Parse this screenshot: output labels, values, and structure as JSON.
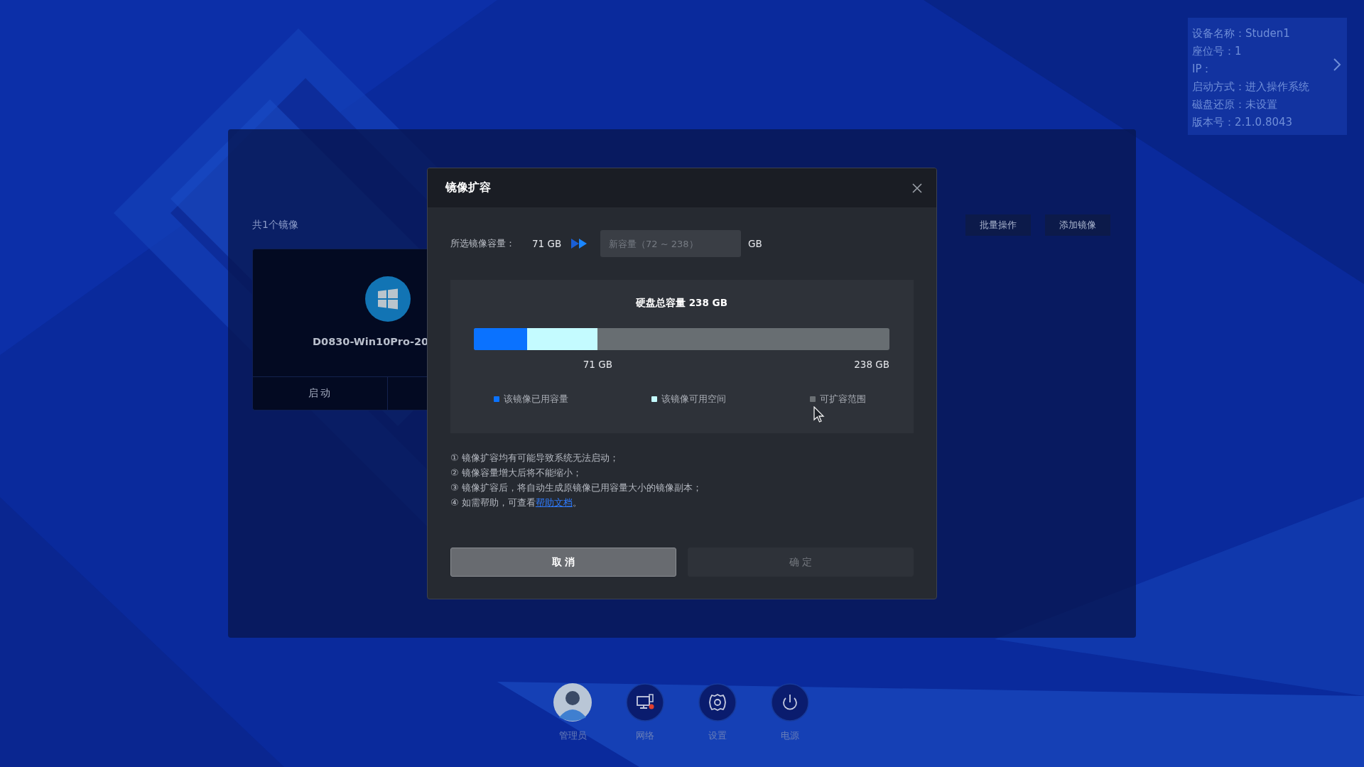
{
  "device_info": {
    "lines": [
      "设备名称：Studen1",
      "座位号：1",
      "IP：",
      "启动方式：进入操作系统",
      "磁盘还原：未设置",
      "版本号：2.1.0.8043"
    ]
  },
  "image_panel": {
    "count_label": "共1个镜像",
    "actions": [
      "批量操作",
      "添加镜像"
    ],
    "card": {
      "name": "D0830-Win10Pro-20",
      "action": "启动"
    }
  },
  "dialog": {
    "title": "镜像扩容",
    "selected_label": "所选镜像容量：",
    "selected_value": "71 GB",
    "new_capacity": {
      "placeholder": "新容量（72 ~ 238）"
    },
    "unit": "GB",
    "disk": {
      "title": "硬盘总容量 238 GB",
      "segments": [
        {
          "level": 0.128
        },
        {
          "level": 0.17
        }
      ],
      "marks": [
        "71 GB",
        "238 GB"
      ],
      "legend": [
        {
          "label": "该镜像已用容量",
          "color": "#0a72ff"
        },
        {
          "label": "该镜像可用空间",
          "color": "#c4fbff"
        },
        {
          "label": "可扩容范围",
          "color": "#6b7074"
        }
      ]
    },
    "notes": [
      {
        "text": "① 镜像扩容均有可能导致系统无法启动；"
      },
      {
        "text": "② 镜像容量增大后将不能缩小；"
      },
      {
        "text": "③ 镜像扩容后，将自动生成原镜像已用容量大小的镜像副本；"
      },
      {
        "text": "④ 如需帮助，可查看",
        "link": "帮助文档",
        "after": "。"
      }
    ],
    "buttons": [
      {
        "label": "取 消",
        "disabled": false
      },
      {
        "label": "确 定",
        "disabled": true
      }
    ]
  },
  "dock": [
    {
      "kind": "avatar",
      "label": "管理员"
    },
    {
      "kind": "network",
      "label": "网络"
    },
    {
      "kind": "settings",
      "label": "设置"
    },
    {
      "kind": "power",
      "label": "电源"
    }
  ]
}
